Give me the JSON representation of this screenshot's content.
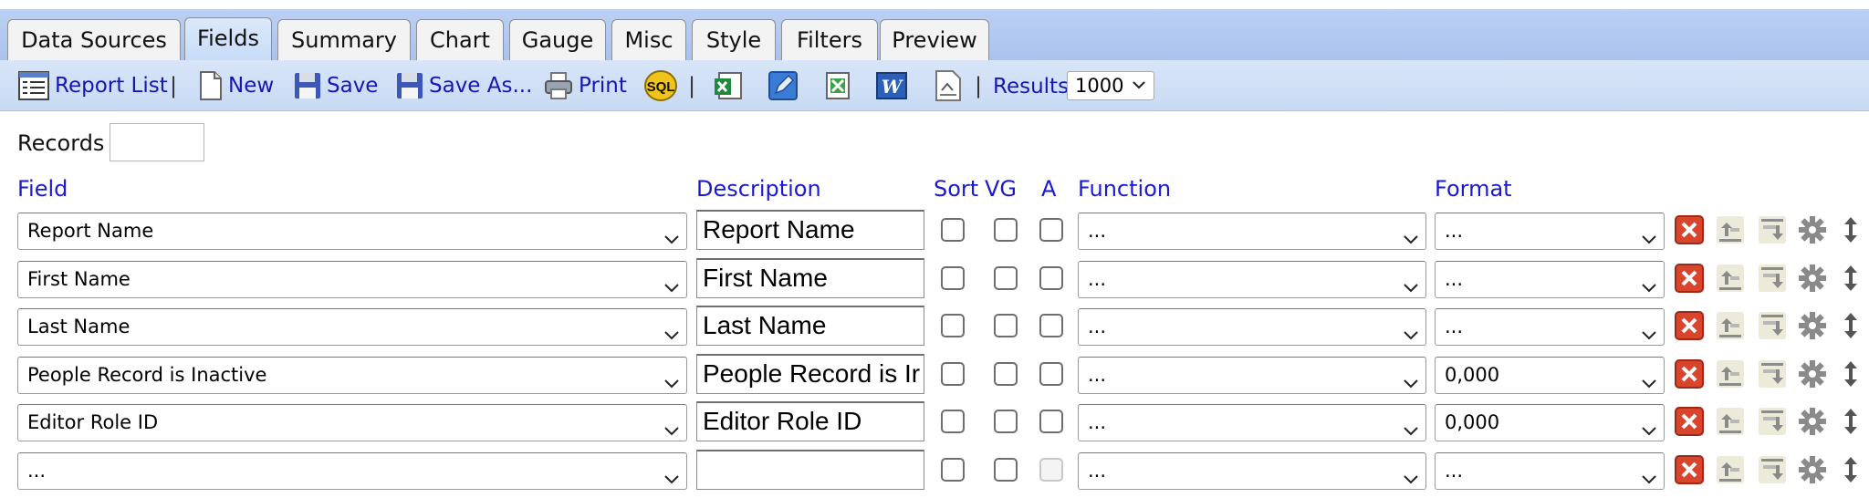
{
  "tabs": [
    "Data Sources",
    "Fields",
    "Summary",
    "Chart",
    "Gauge",
    "Misc",
    "Style",
    "Filters",
    "Preview"
  ],
  "active_tab": "Fields",
  "toolbar": {
    "report_list": "Report List",
    "new": "New",
    "save": "Save",
    "save_as": "Save As...",
    "print": "Print",
    "sql_icon_text": "SQL",
    "results_label": "Results",
    "results_value": "1000"
  },
  "records": {
    "label": "Records",
    "value": ""
  },
  "headers": {
    "field": "Field",
    "description": "Description",
    "sort": "Sort",
    "vg": "VG",
    "a": "A",
    "function": "Function",
    "format": "Format"
  },
  "rows": [
    {
      "field": "Report Name",
      "description": "Report Name",
      "function": "...",
      "format": "..."
    },
    {
      "field": "First Name",
      "description": "First Name",
      "function": "...",
      "format": "..."
    },
    {
      "field": "Last Name",
      "description": "Last Name",
      "function": "...",
      "format": "..."
    },
    {
      "field": "People Record is Inactive",
      "description": "People Record is Ir",
      "function": "...",
      "format": "0,000"
    },
    {
      "field": "Editor Role ID",
      "description": "Editor Role ID",
      "function": "...",
      "format": "0,000"
    },
    {
      "field": "...",
      "description": "",
      "function": "...",
      "format": "..."
    }
  ],
  "colors": {
    "link_blue": "#1a1ad0",
    "tab_bg": "#a9c2ee",
    "delete_red": "#d9452c"
  }
}
